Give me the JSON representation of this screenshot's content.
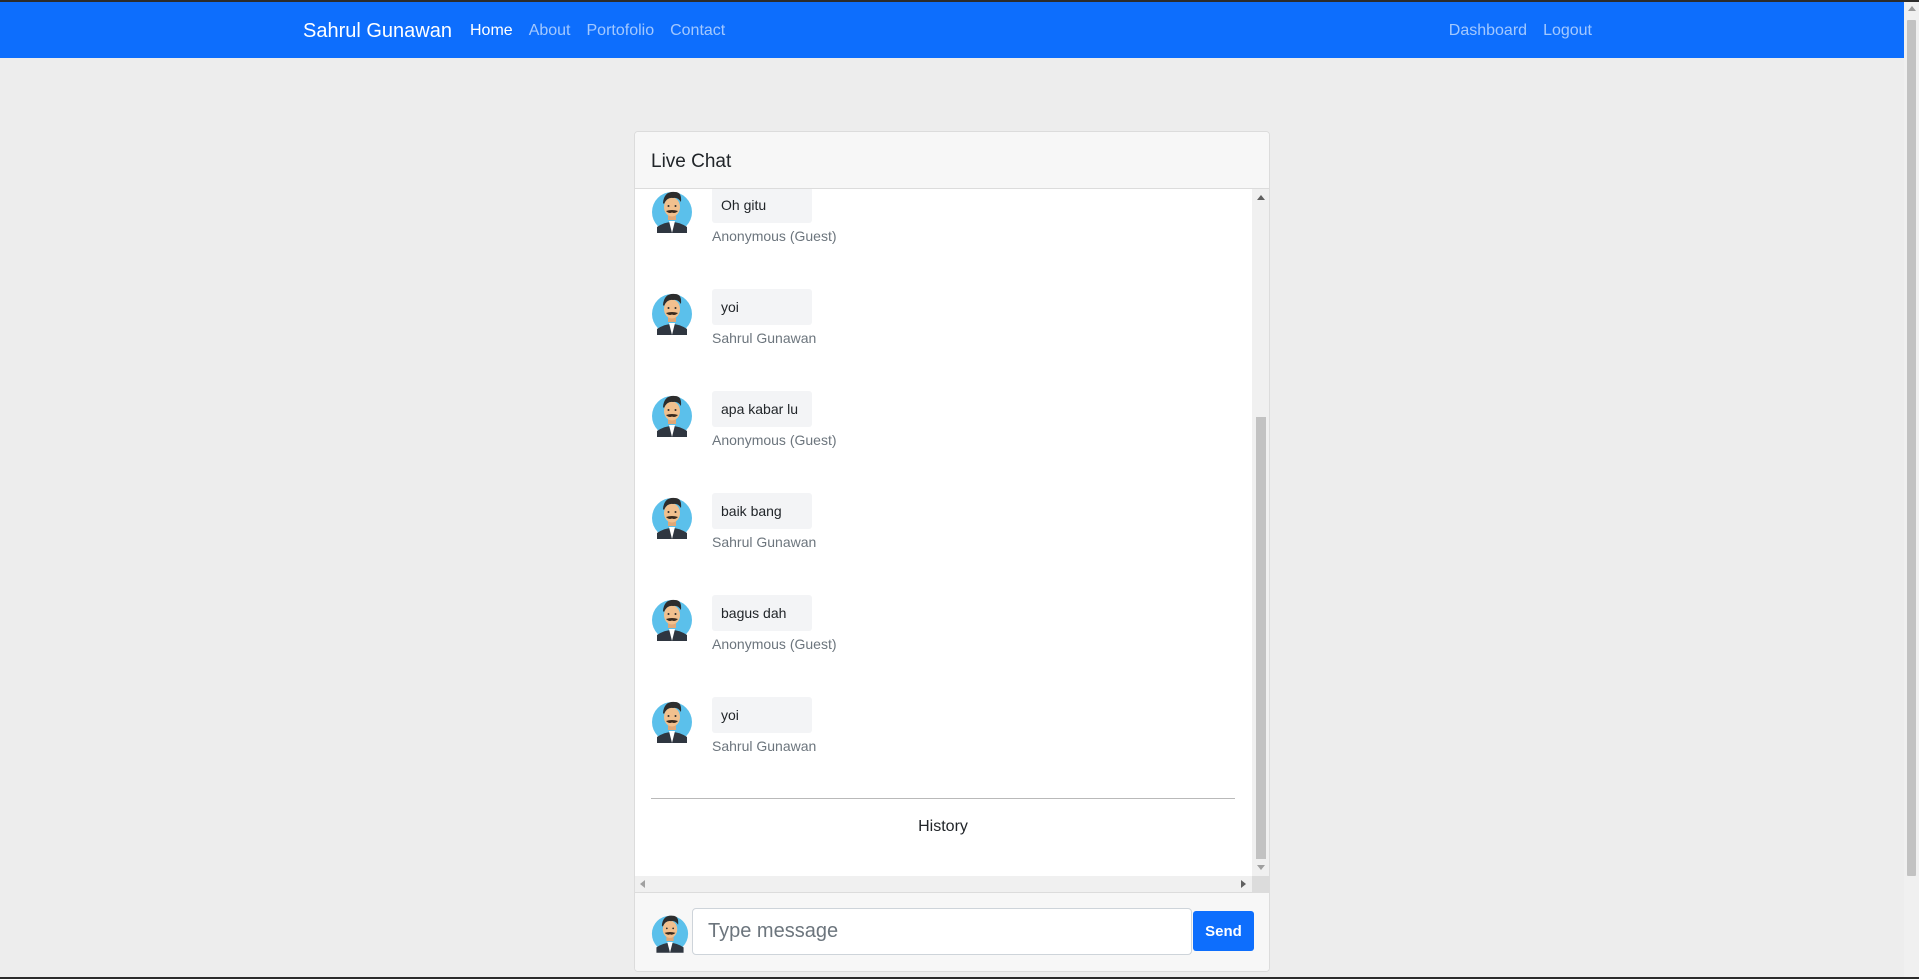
{
  "navbar": {
    "brand": "Sahrul Gunawan",
    "links": [
      {
        "label": "Home",
        "active": true
      },
      {
        "label": "About"
      },
      {
        "label": "Portofolio"
      },
      {
        "label": "Contact"
      }
    ],
    "right_links": [
      {
        "label": "Dashboard"
      },
      {
        "label": "Logout"
      }
    ]
  },
  "chat": {
    "title": "Live Chat",
    "messages": [
      {
        "text": "Oh gitu",
        "sender": "Anonymous (Guest)"
      },
      {
        "text": "yoi",
        "sender": "Sahrul Gunawan"
      },
      {
        "text": "apa kabar lu",
        "sender": "Anonymous (Guest)"
      },
      {
        "text": "baik bang",
        "sender": "Sahrul Gunawan"
      },
      {
        "text": "bagus dah",
        "sender": "Anonymous (Guest)"
      },
      {
        "text": "yoi",
        "sender": "Sahrul Gunawan"
      }
    ],
    "history_label": "History",
    "input": {
      "placeholder": "Type message",
      "value": ""
    },
    "send_label": "Send"
  },
  "colors": {
    "primary": "#0d6efd",
    "page_background": "#ededed",
    "bubble_background": "#f3f4f6",
    "avatar_background": "#5bc0eb"
  },
  "icons": {
    "avatar": "man-avatar-icon"
  }
}
